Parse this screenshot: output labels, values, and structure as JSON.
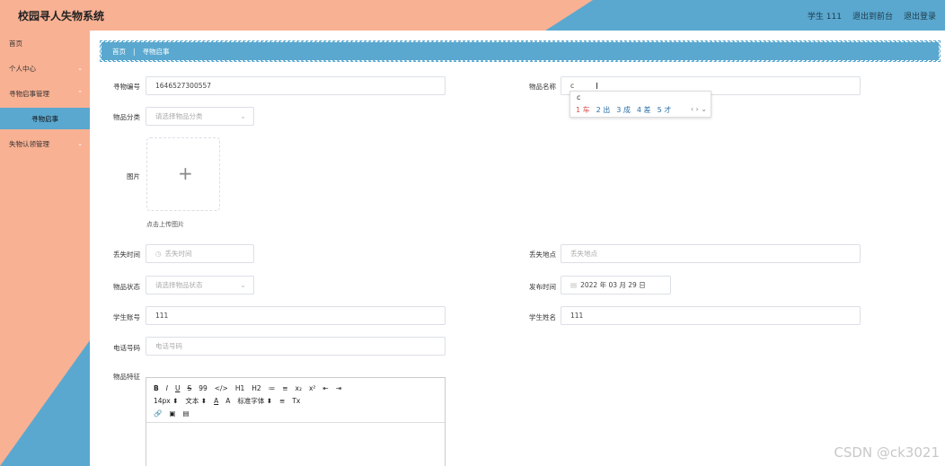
{
  "header": {
    "title": "校园寻人失物系统",
    "user": "学生 111",
    "back_to_admin": "退出到前台",
    "logout": "退出登录"
  },
  "colors": {
    "salmon": "#f9b193",
    "blue": "#5aa8cf"
  },
  "sidebar": {
    "items": [
      {
        "label": "首页"
      },
      {
        "label": "个人中心"
      },
      {
        "label": "寻物启事管理"
      },
      {
        "label": "寻物启事"
      },
      {
        "label": "失物认领管理"
      }
    ]
  },
  "breadcrumb": {
    "home": "首页",
    "separator": "|",
    "current": "寻物启事"
  },
  "form": {
    "item_no": {
      "label": "寻物编号",
      "value": "1646527300557"
    },
    "item_name": {
      "label": "物品名称",
      "value": "c"
    },
    "category": {
      "label": "物品分类",
      "placeholder": "请选择物品分类"
    },
    "image": {
      "label": "图片",
      "tip": "点击上传图片"
    },
    "lost_time": {
      "label": "丢失时间",
      "placeholder": "丢失时间"
    },
    "lost_place": {
      "label": "丢失地点",
      "placeholder": "丢失地点"
    },
    "status": {
      "label": "物品状态",
      "placeholder": "请选择物品状态"
    },
    "publish_time": {
      "label": "发布时间",
      "value": "2022 年 03 月 29 日"
    },
    "student_no": {
      "label": "学生账号",
      "value": "111"
    },
    "student_name": {
      "label": "学生姓名",
      "value": "111"
    },
    "phone": {
      "label": "电话号码",
      "placeholder": "电话号码"
    },
    "features": {
      "label": "物品特征"
    }
  },
  "ime": {
    "composition": "c",
    "candidates": [
      "1 车",
      "2 出",
      "3 成",
      "4 差",
      "5 才"
    ],
    "nav": "‹ › ⌄"
  },
  "editor": {
    "row1": [
      "B",
      "I",
      "U",
      "S",
      "99",
      "</>",
      "H1",
      "H2",
      "≔",
      "≡",
      "x₂",
      "x²",
      "⇤",
      "⇥"
    ],
    "row2": [
      "14px ⬍",
      "文本 ⬍",
      "A",
      "A",
      "标准字体 ⬍",
      "≡",
      "Tx"
    ],
    "row3": [
      "🔗",
      "▣",
      "▤"
    ]
  },
  "watermark": "CSDN @ck3021"
}
